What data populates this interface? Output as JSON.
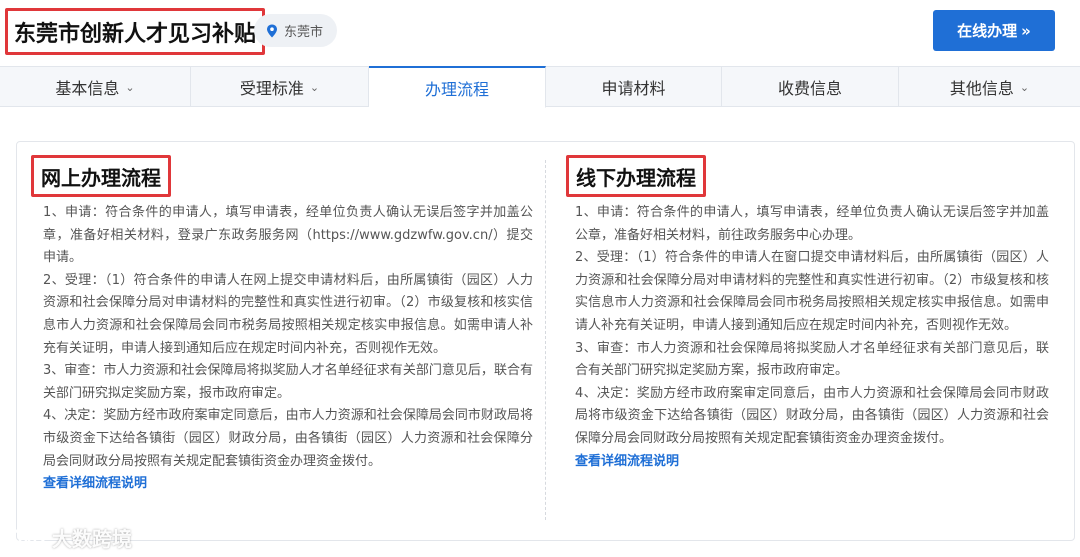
{
  "header": {
    "title": "东莞市创新人才见习补贴",
    "location": "东莞市",
    "online_button": "在线办理",
    "online_button_arrow": "»"
  },
  "tabs": [
    {
      "label": "基本信息",
      "dropdown": true
    },
    {
      "label": "受理标准",
      "dropdown": true
    },
    {
      "label": "办理流程",
      "dropdown": false,
      "active": true
    },
    {
      "label": "申请材料",
      "dropdown": false
    },
    {
      "label": "收费信息",
      "dropdown": false
    },
    {
      "label": "其他信息",
      "dropdown": true
    }
  ],
  "online": {
    "title": "网上办理流程",
    "paragraphs": [
      "1、申请：符合条件的申请人，填写申请表，经单位负责人确认无误后签字并加盖公章，准备好相关材料，登录广东政务服务网（https://www.gdzwfw.gov.cn/）提交申请。",
      "2、受理：（1）符合条件的申请人在网上提交申请材料后，由所属镇街（园区）人力资源和社会保障分局对申请材料的完整性和真实性进行初审。（2）市级复核和核实信息市人力资源和社会保障局会同市税务局按照相关规定核实申报信息。如需申请人补充有关证明，申请人接到通知后应在规定时间内补充，否则视作无效。",
      "3、审查：市人力资源和社会保障局将拟奖励人才名单经征求有关部门意见后，联合有关部门研究拟定奖励方案，报市政府审定。",
      "4、决定：奖励方经市政府案审定同意后，由市人力资源和社会保障局会同市财政局将市级资金下达给各镇街（园区）财政分局，由各镇街（园区）人力资源和社会保障分局会同财政分局按照有关规定配套镇街资金办理资金拨付。"
    ],
    "link": "查看详细流程说明"
  },
  "offline": {
    "title": "线下办理流程",
    "paragraphs": [
      "1、申请：符合条件的申请人，填写申请表，经单位负责人确认无误后签字并加盖公章，准备好相关材料，前往政务服务中心办理。",
      "2、受理：（1）符合条件的申请人在窗口提交申请材料后，由所属镇街（园区）人力资源和社会保障分局对申请材料的完整性和真实性进行初审。（2）市级复核和核实信息市人力资源和社会保障局会同市税务局按照相关规定核实申报信息。如需申请人补充有关证明，申请人接到通知后应在规定时间内补充，否则视作无效。",
      "3、审查：市人力资源和社会保障局将拟奖励人才名单经征求有关部门意见后，联合有关部门研究拟定奖励方案，报市政府审定。",
      "4、决定：奖励方经市政府案审定同意后，由市人力资源和社会保障局会同市财政局将市级资金下达给各镇街（园区）财政分局，由各镇街（园区）人力资源和社会保障分局会同财政分局按照有关规定配套镇街资金办理资金拨付。"
    ],
    "link": "查看详细流程说明"
  },
  "watermark": {
    "text": "大数跨境"
  },
  "colors": {
    "accent": "#1f6fd6",
    "highlight_border": "#e0373a"
  }
}
